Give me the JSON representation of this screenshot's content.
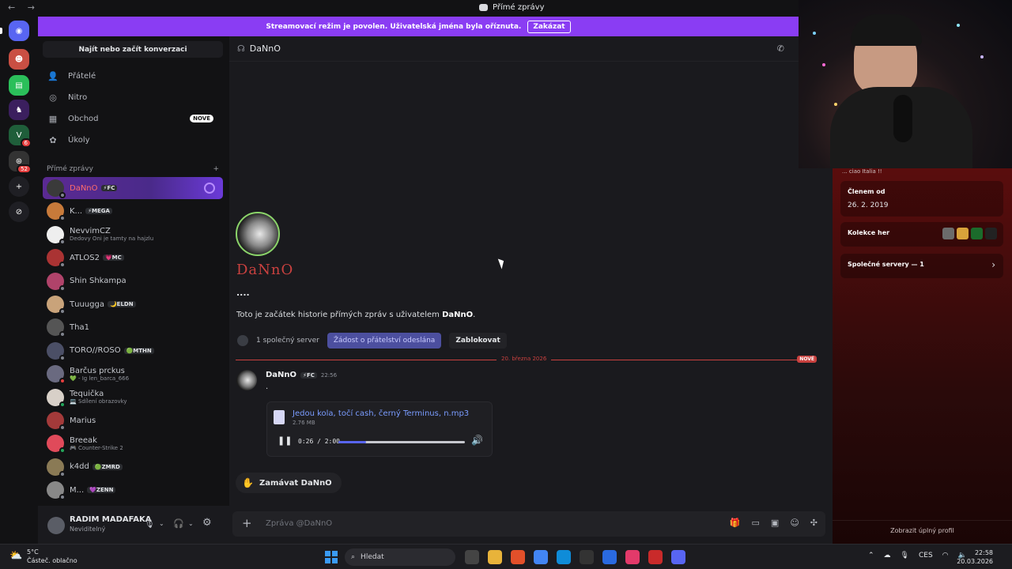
{
  "window": {
    "title": "Přímé zprávy",
    "nav_arrows": "← →"
  },
  "banner": {
    "text": "Streamovací režim je povolen. Uživatelská jména byla oříznuta.",
    "button": "Zakázat"
  },
  "rail": {
    "servers": [
      {
        "name": "discord-home",
        "color": "#5865f2",
        "glyph": "◉"
      },
      {
        "name": "server-1",
        "color": "#c94f43",
        "glyph": "☻"
      },
      {
        "name": "server-2",
        "color": "#2bbf5a",
        "glyph": "▤"
      },
      {
        "name": "server-3",
        "color": "#3b1f5e",
        "glyph": "♞"
      },
      {
        "name": "server-4",
        "color": "#1f5e3a",
        "glyph": "V",
        "badge": "6"
      },
      {
        "name": "server-5",
        "color": "#333",
        "glyph": "⊛",
        "badge": "52"
      },
      {
        "name": "add-server",
        "color": "#1f1f24",
        "glyph": "+"
      },
      {
        "name": "discover",
        "color": "#1f1f24",
        "glyph": "⊘"
      }
    ]
  },
  "sidebar": {
    "search_label": "Najít nebo začít konverzaci",
    "nav": [
      {
        "label": "Přátelé",
        "icon": "👤"
      },
      {
        "label": "Nitro",
        "icon": "◎"
      },
      {
        "label": "Obchod",
        "icon": "▦",
        "badge": "NOVÉ"
      },
      {
        "label": "Úkoly",
        "icon": "✿"
      }
    ],
    "dm_header": "Přímé zprávy",
    "dm_add": "+",
    "dms": [
      {
        "name": "DaNnO",
        "tag": "⚡FC",
        "sub": "",
        "color": "#3a3a3a",
        "status": "#80848e",
        "active": true
      },
      {
        "name": "K...",
        "tag": "⚡MEGA",
        "sub": "",
        "color": "#c77a3a",
        "status": "#80848e"
      },
      {
        "name": "NevvimCZ",
        "tag": "",
        "sub": "Dedovy Oni je tamty na hajzlu",
        "color": "#eeeeee",
        "status": "#80848e"
      },
      {
        "name": "ATLOS2",
        "tag": "💗MC",
        "sub": "",
        "color": "#a33",
        "status": "#80848e"
      },
      {
        "name": "Shin Shkampa",
        "tag": "",
        "sub": "",
        "color": "#b0436a",
        "status": "#80848e"
      },
      {
        "name": "Ꚍuuugga",
        "tag": "🌙ELDN",
        "sub": "",
        "color": "#c9a37a",
        "status": "#80848e"
      },
      {
        "name": "Tha1",
        "tag": "",
        "sub": "",
        "color": "#555",
        "status": "#80848e"
      },
      {
        "name": "TORO//ROSO",
        "tag": "🟢MTHN",
        "sub": "",
        "color": "#4b4f66",
        "status": "#80848e"
      },
      {
        "name": "Barčus prckus",
        "tag": "",
        "sub": "💚 - Ig len_barca_666",
        "color": "#6a6a80",
        "status": "#e53e3e"
      },
      {
        "name": "Tequička",
        "tag": "",
        "sub": "💻 Sdílení obrazovky",
        "color": "#d8d0c8",
        "status": "#23a55a"
      },
      {
        "name": "Marius",
        "tag": "",
        "sub": "",
        "color": "#a33a3a",
        "status": "#80848e"
      },
      {
        "name": "Breeak",
        "tag": "",
        "sub": "🎮 Counter-Strike 2",
        "color": "#e04a5a",
        "status": "#23a55a"
      },
      {
        "name": "k4dd",
        "tag": "🟢ZMRD",
        "sub": "",
        "color": "#8a7a55",
        "status": "#80848e"
      },
      {
        "name": "M...",
        "tag": "💜ZENN",
        "sub": "",
        "color": "#888",
        "status": "#80848e"
      }
    ]
  },
  "user": {
    "name": "RADIM MADAFAKA",
    "status": "Neviditelný"
  },
  "chat": {
    "recipient": "DaNnO",
    "big_name": "DaNnO",
    "dots": "....",
    "intro_prefix": "Toto je začátek historie přímých zpráv s uživatelem ",
    "intro_name": "DaNnO",
    "intro_suffix": ".",
    "mutual_servers": "1 společný server",
    "friend_request": "Žádost o přátelství odeslána",
    "block": "Zablokovat",
    "divider_date": "20. března 2026",
    "divider_new": "NOVÉ",
    "message": {
      "author": "DaNnO",
      "tag": "⚡FC",
      "time": "22:56",
      "text": ".",
      "attachment": {
        "filename": "Jedou kola, točí cash, černý Terminus, n.mp3",
        "size": "2.76 MB",
        "time": "0:26 / 2:00",
        "progress": 0.22
      }
    },
    "wave_label": "Zamávat DaNnO",
    "composer_placeholder": "Zpráva @DaNnO"
  },
  "profile": {
    "cut_text": "... ciao Italia !!",
    "member_since_label": "Členem od",
    "member_since": "26. 2. 2019",
    "games_label": "Kolekce her",
    "mutual_label": "Společné servery — 1",
    "view_full": "Zobrazit úplný profil",
    "game_colors": [
      "#6b6b6b",
      "#d8a23a",
      "#1b6b2b",
      "#222"
    ]
  },
  "taskbar": {
    "temp": "5°C",
    "condition": "Částeč. oblačno",
    "search": "Hledat",
    "lang": "CES",
    "time": "22:58",
    "date": "20.03.2026",
    "app_colors": [
      "#444",
      "#e8b33a",
      "#e2502a",
      "#4285f4",
      "#0f8cd8",
      "#333",
      "#2a6ae0",
      "#e33a6a",
      "#c92a2a",
      "#5865f2"
    ]
  }
}
